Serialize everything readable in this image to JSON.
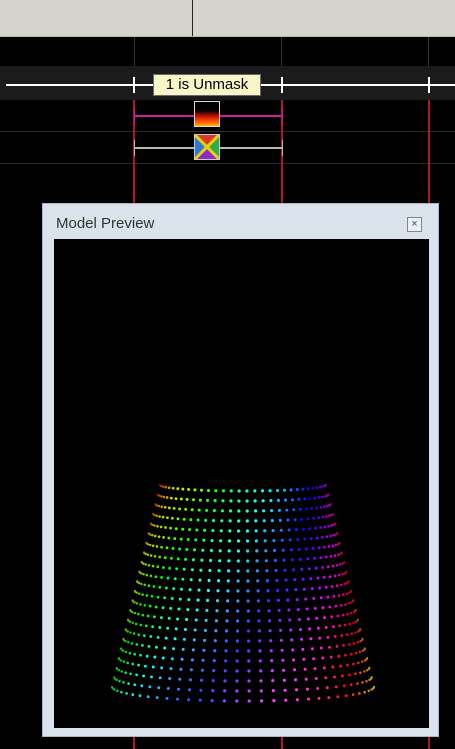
{
  "timeline": {
    "timing_label": "1 is Unmask"
  },
  "preview": {
    "title": "Model Preview",
    "close_icon": "close-icon",
    "model_shape": "tapered cylinder of colored pixels (rainbow gradient)"
  },
  "colors": {
    "header_bg": "#d6d3ce",
    "timeline_bg": "#000000",
    "cursor_line": "#b0162c",
    "effect_bar_magenta": "#c8209a",
    "effect_bar_gray": "#b9b9b9",
    "label_bg": "#f8f5c8",
    "window_frame": "#dae3ec"
  }
}
